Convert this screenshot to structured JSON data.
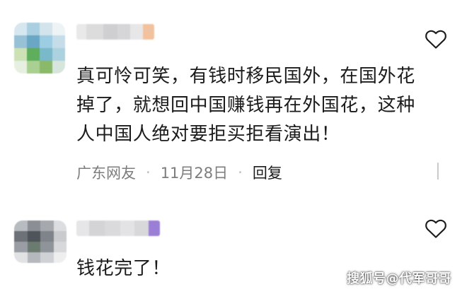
{
  "comments": [
    {
      "text": "真可怜可笑，有钱时移民国外，在国外花\n掉了，就想回中国赚钱再在外国花，这种\n人中国人绝对要拒买拒看演出！",
      "location": "广东网友",
      "date": "11月28日",
      "separator": "·",
      "reply_label": "回复",
      "heart_icon": "heart-outline-icon"
    },
    {
      "text": "钱花完了！",
      "heart_icon": "heart-outline-icon"
    }
  ],
  "watermark": "搜狐号@代军哥哥"
}
